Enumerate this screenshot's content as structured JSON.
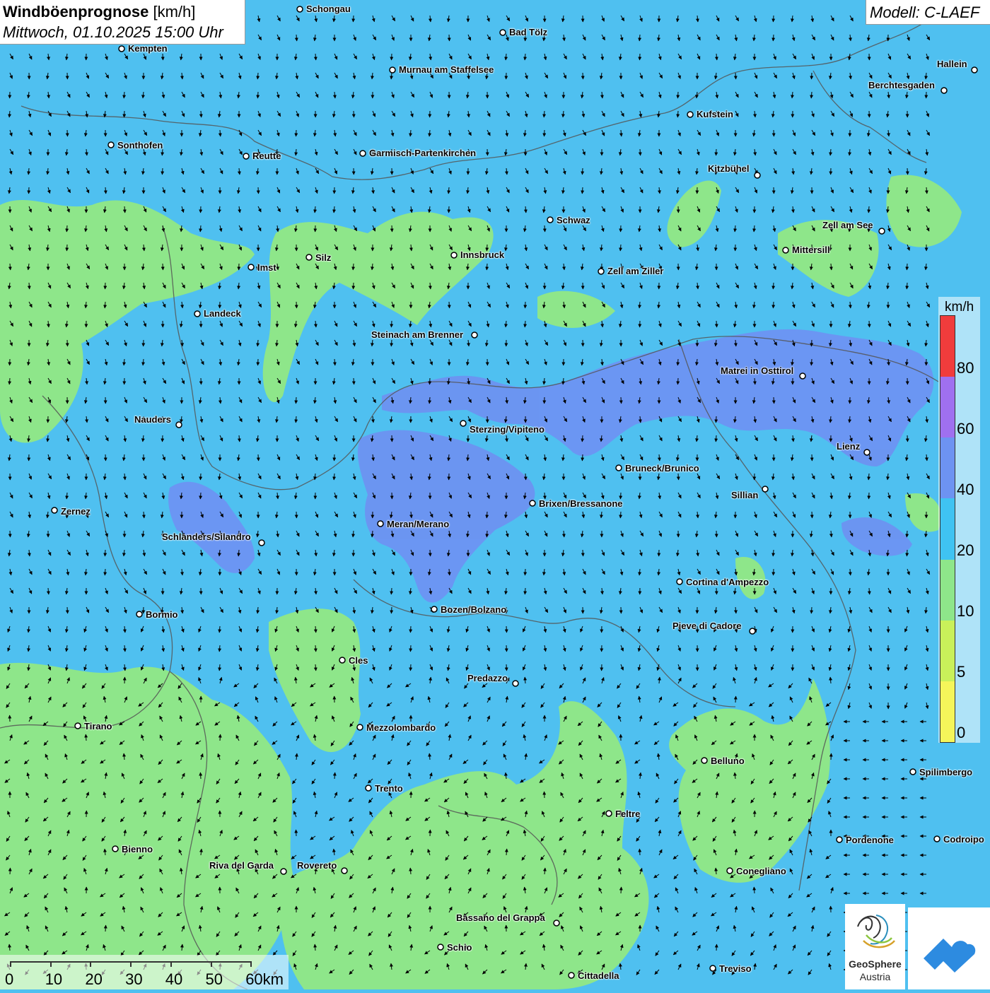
{
  "header": {
    "title_bold": "Windböenprognose",
    "title_unit": " [km/h]",
    "subtitle": "Mittwoch, 01.10.2025 15:00 Uhr",
    "model": "Modell: C-LAEF"
  },
  "legend": {
    "unit": "km/h",
    "classes": [
      {
        "from": 0,
        "to": 5,
        "color": "#f5f55a"
      },
      {
        "from": 5,
        "to": 10,
        "color": "#c9f05a"
      },
      {
        "from": 10,
        "to": 20,
        "color": "#8ee68a"
      },
      {
        "from": 20,
        "to": 40,
        "color": "#3fc3f2"
      },
      {
        "from": 40,
        "to": 60,
        "color": "#6d93f2"
      },
      {
        "from": 60,
        "to": 80,
        "color": "#9f70f0"
      },
      {
        "from": 80,
        "to": 100,
        "color": "#f03c3c"
      }
    ],
    "ticks": [
      "80",
      "60",
      "40",
      "20",
      "10",
      "5",
      "0"
    ]
  },
  "scale_bar": {
    "labels": [
      "0",
      "10",
      "20",
      "30",
      "40",
      "50",
      "60km"
    ]
  },
  "logo": {
    "name_line1": "GeoSphere",
    "name_line2": "Austria",
    "icon": "geosphere-logo-icon",
    "app_icon": "weather-app-icon"
  },
  "cities": [
    {
      "id": "schongau",
      "name": "Schongau"
    },
    {
      "id": "bad-toelz",
      "name": "Bad Tölz"
    },
    {
      "id": "kempten",
      "name": "Kempten"
    },
    {
      "id": "murnau",
      "name": "Murnau am Staffelsee"
    },
    {
      "id": "hallein",
      "name": "Hallein"
    },
    {
      "id": "berchtesgaden",
      "name": "Berchtesgaden"
    },
    {
      "id": "kufstein",
      "name": "Kufstein"
    },
    {
      "id": "sonthofen",
      "name": "Sonthofen"
    },
    {
      "id": "reutte",
      "name": "Reutte"
    },
    {
      "id": "garmisch",
      "name": "Garmisch-Partenkirchen"
    },
    {
      "id": "kitzbuehel",
      "name": "Kitzbühel"
    },
    {
      "id": "schwaz",
      "name": "Schwaz"
    },
    {
      "id": "zell-am-see",
      "name": "Zell am See"
    },
    {
      "id": "silz",
      "name": "Silz"
    },
    {
      "id": "innsbruck",
      "name": "Innsbruck"
    },
    {
      "id": "mittersill",
      "name": "Mittersill"
    },
    {
      "id": "imst",
      "name": "Imst"
    },
    {
      "id": "zell-am-ziller",
      "name": "Zell am Ziller"
    },
    {
      "id": "landeck",
      "name": "Landeck"
    },
    {
      "id": "steinach",
      "name": "Steinach am Brenner"
    },
    {
      "id": "matrei",
      "name": "Matrei in Osttirol"
    },
    {
      "id": "nauders",
      "name": "Nauders"
    },
    {
      "id": "sterzing",
      "name": "Sterzing/Vipiteno"
    },
    {
      "id": "lienz",
      "name": "Lienz"
    },
    {
      "id": "bruneck",
      "name": "Bruneck/Brunico"
    },
    {
      "id": "sillian",
      "name": "Sillian"
    },
    {
      "id": "brixen",
      "name": "Brixen/Bressanone"
    },
    {
      "id": "zernez",
      "name": "Zernez"
    },
    {
      "id": "meran",
      "name": "Meran/Merano"
    },
    {
      "id": "schlanders",
      "name": "Schlanders/Silandro"
    },
    {
      "id": "cortina",
      "name": "Cortina d'Ampezzo"
    },
    {
      "id": "bozen",
      "name": "Bozen/Bolzano"
    },
    {
      "id": "bormio",
      "name": "Bormio"
    },
    {
      "id": "pieve",
      "name": "Pieve di Cadore"
    },
    {
      "id": "cles",
      "name": "Cles"
    },
    {
      "id": "predazzo",
      "name": "Predazzo"
    },
    {
      "id": "tirano",
      "name": "Tirano"
    },
    {
      "id": "mezzolombardo",
      "name": "Mezzolombardo"
    },
    {
      "id": "belluno",
      "name": "Belluno"
    },
    {
      "id": "spilimbergo",
      "name": "Spilimbergo"
    },
    {
      "id": "trento",
      "name": "Trento"
    },
    {
      "id": "feltre",
      "name": "Feltre"
    },
    {
      "id": "pordenone",
      "name": "Pordenone"
    },
    {
      "id": "codroipo",
      "name": "Codroipo"
    },
    {
      "id": "bienno",
      "name": "Bienno"
    },
    {
      "id": "riva",
      "name": "Riva del Garda"
    },
    {
      "id": "rovereto",
      "name": "Rovereto"
    },
    {
      "id": "conegliano",
      "name": "Conegliano"
    },
    {
      "id": "bassano",
      "name": "Bassano del Grappa"
    },
    {
      "id": "schio",
      "name": "Schio"
    },
    {
      "id": "treviso",
      "name": "Treviso"
    },
    {
      "id": "cittadella",
      "name": "Cittadella"
    }
  ]
}
